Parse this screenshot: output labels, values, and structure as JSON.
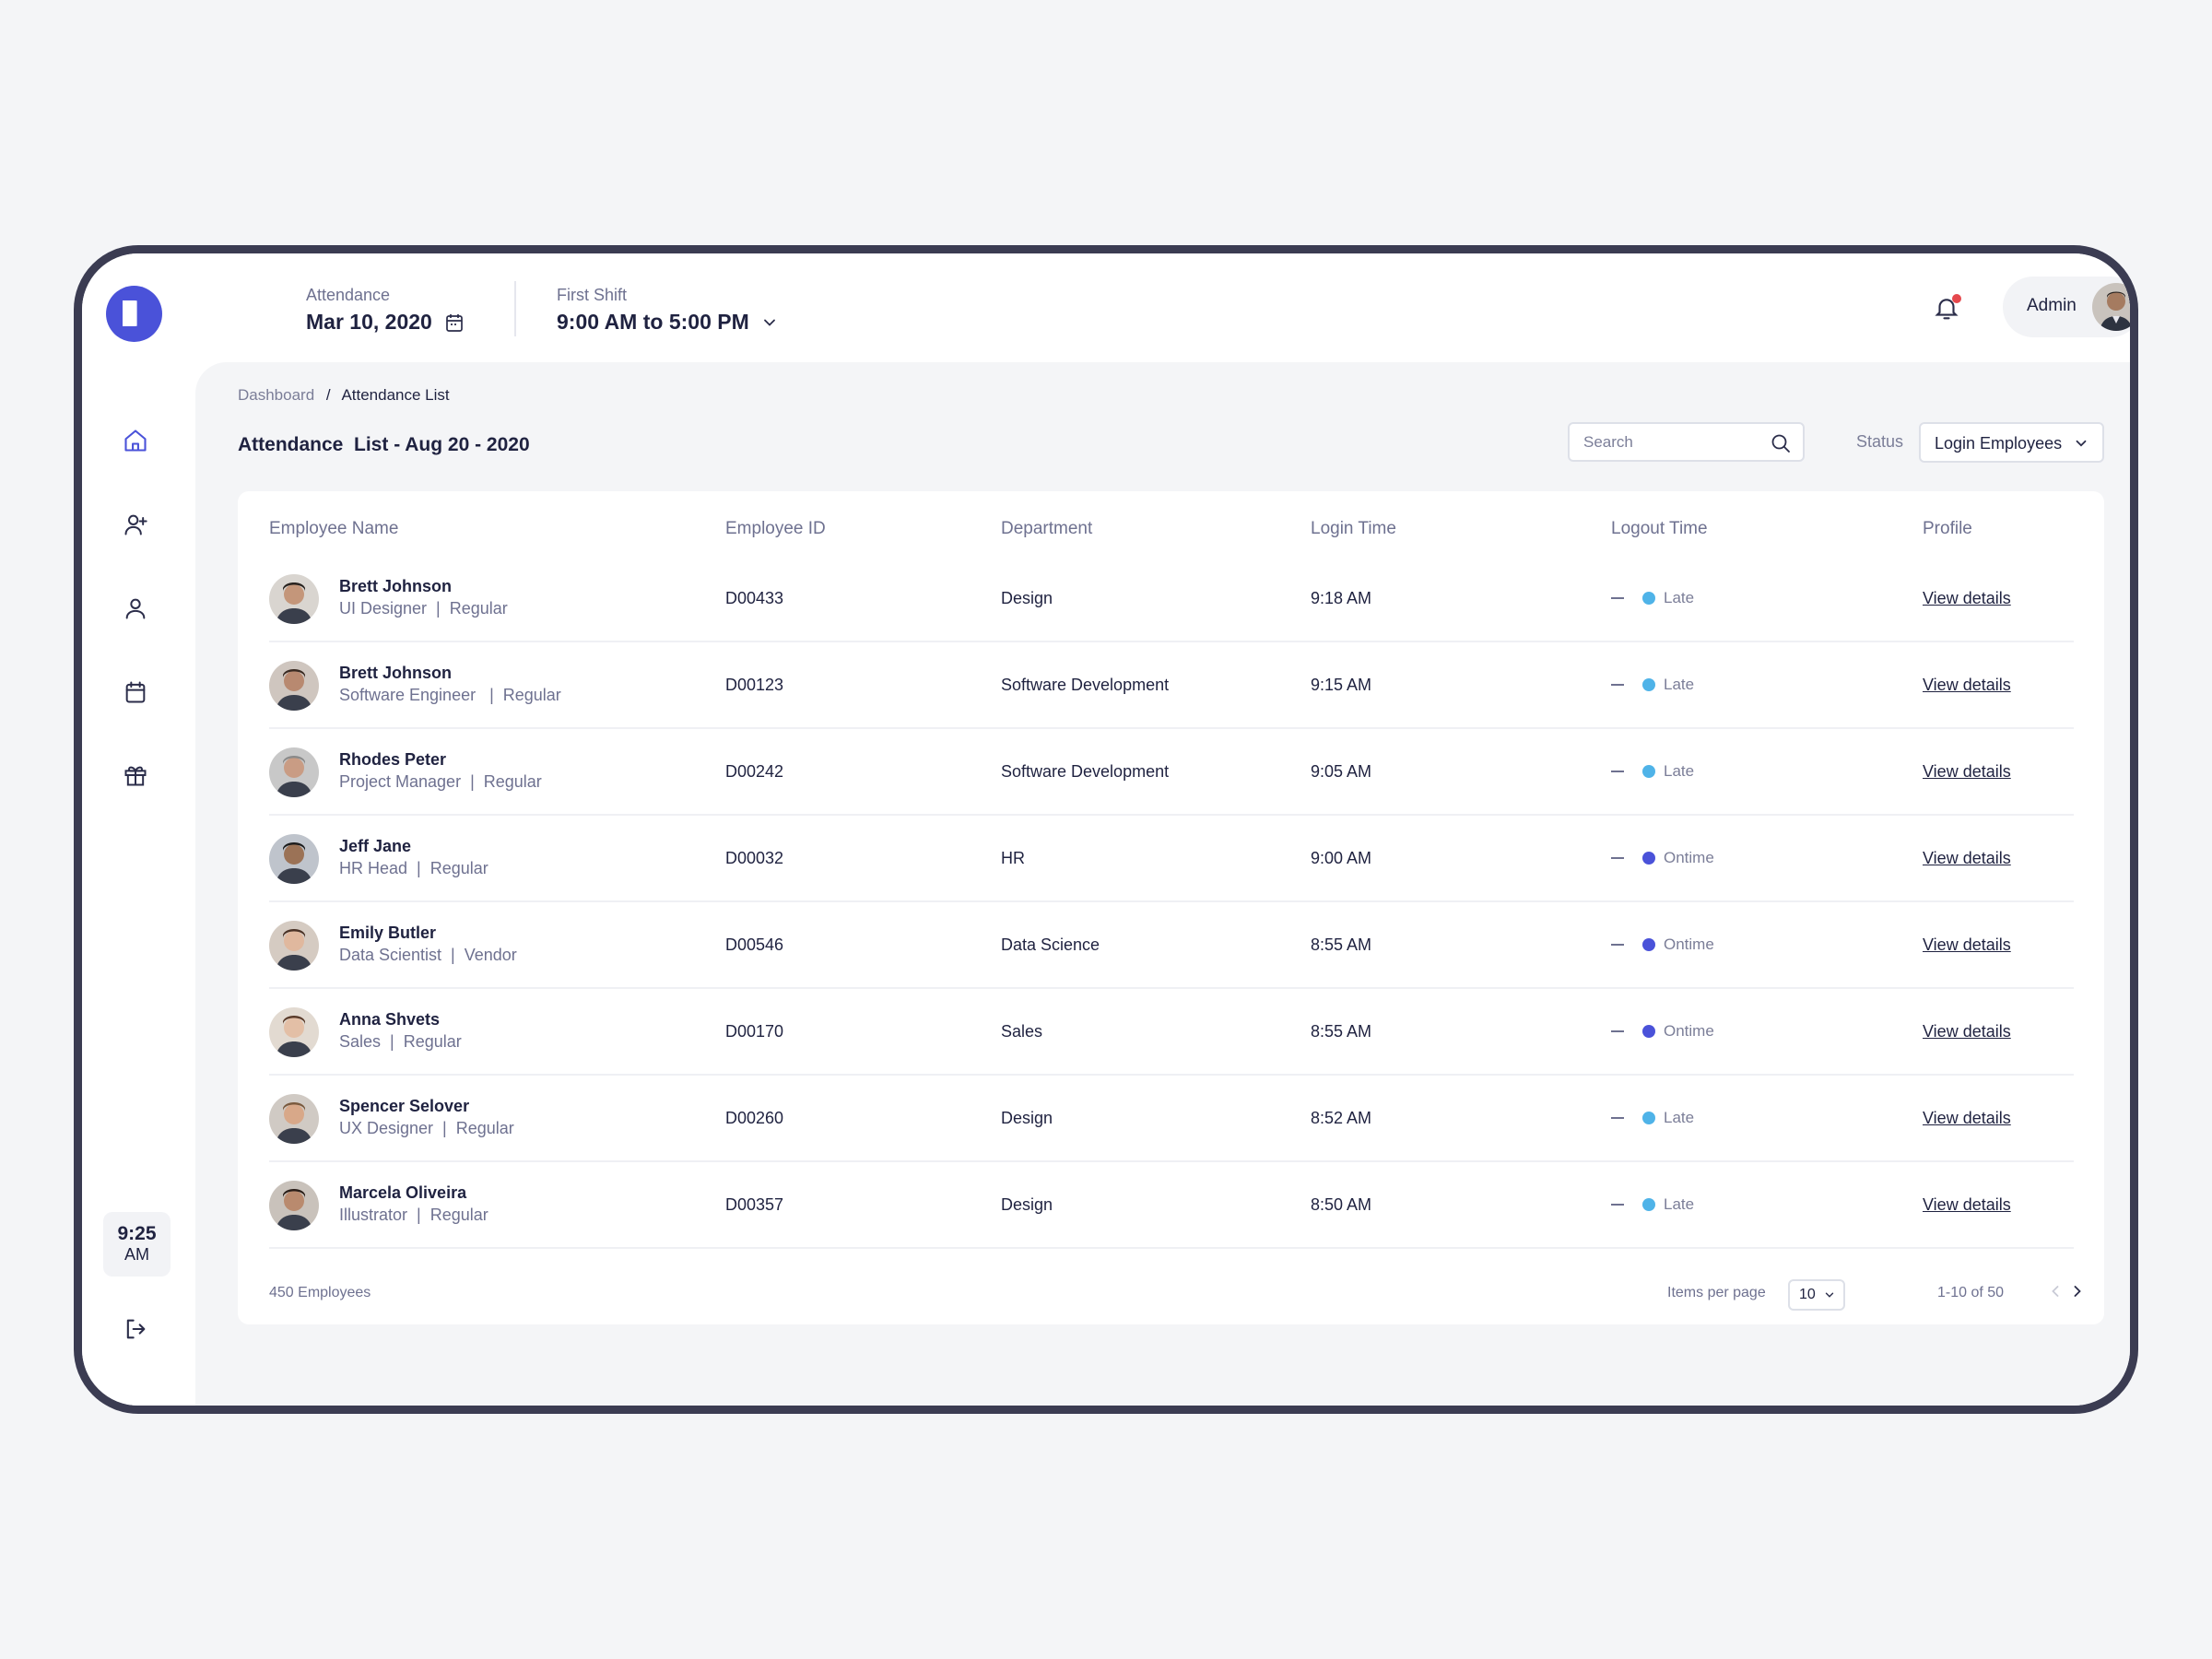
{
  "header": {
    "attendance_label": "Attendance",
    "date_value": "Mar 10, 2020",
    "shift_label": "First Shift",
    "shift_value": "9:00 AM to 5:00 PM",
    "admin_name": "Admin"
  },
  "sidebar": {
    "clock_time": "9:25",
    "clock_ampm": "AM",
    "icons": [
      "home-icon",
      "add-user-icon",
      "user-icon",
      "calendar-icon",
      "gift-icon",
      "logout-icon"
    ]
  },
  "breadcrumb": {
    "root": "Dashboard",
    "separator": "/",
    "current": "Attendance List"
  },
  "page": {
    "title": "Attendance  List - Aug 20 - 2020",
    "search_placeholder": "Search",
    "status_label": "Status",
    "status_value": "Login Employees"
  },
  "table": {
    "columns": [
      "Employee Name",
      "Employee ID",
      "Department",
      "Login Time",
      "Logout Time",
      "Profile"
    ],
    "rows": [
      {
        "name": "Brett Johnson",
        "role": "UI Designer  |  Regular",
        "id": "D00433",
        "dept": "Design",
        "login": "9:18 AM",
        "status": "Late",
        "logout": "",
        "profile": "View details"
      },
      {
        "name": "Brett Johnson",
        "role": "Software Engineer   |  Regular",
        "id": "D00123",
        "dept": "Software Development",
        "login": "9:15 AM",
        "status": "Late",
        "logout": "",
        "profile": "View details"
      },
      {
        "name": "Rhodes Peter",
        "role": "Project Manager  |  Regular",
        "id": "D00242",
        "dept": "Software Development",
        "login": "9:05 AM",
        "status": "Late",
        "logout": "",
        "profile": "View details"
      },
      {
        "name": "Jeff Jane",
        "role": "HR Head  |  Regular",
        "id": "D00032",
        "dept": "HR",
        "login": "9:00 AM",
        "status": "Ontime",
        "logout": "",
        "profile": "View details"
      },
      {
        "name": "Emily Butler",
        "role": "Data Scientist  |  Vendor",
        "id": "D00546",
        "dept": "Data Science",
        "login": "8:55 AM",
        "status": "Ontime",
        "logout": "",
        "profile": "View details"
      },
      {
        "name": "Anna Shvets",
        "role": "Sales  |  Regular",
        "id": "D00170",
        "dept": "Sales",
        "login": "8:55 AM",
        "status": "Ontime",
        "logout": "",
        "profile": "View details"
      },
      {
        "name": "Spencer Selover",
        "role": "UX Designer  |  Regular",
        "id": "D00260",
        "dept": "Design",
        "login": "8:52 AM",
        "status": "Late",
        "logout": "",
        "profile": "View details"
      },
      {
        "name": "Marcela Oliveira",
        "role": "Illustrator  |  Regular",
        "id": "D00357",
        "dept": "Design",
        "login": "8:50 AM",
        "status": "Late",
        "logout": "",
        "profile": "View details"
      }
    ]
  },
  "footer": {
    "employee_count": "450 Employees",
    "items_per_page_label": "Items per page",
    "items_per_page_value": "10",
    "range": "1-10 of 50"
  },
  "colors": {
    "accent": "#4a52d9",
    "late": "#4fb3e8",
    "ontime": "#4a52d9",
    "frame": "#3b3c52",
    "notification": "#e5484d"
  }
}
